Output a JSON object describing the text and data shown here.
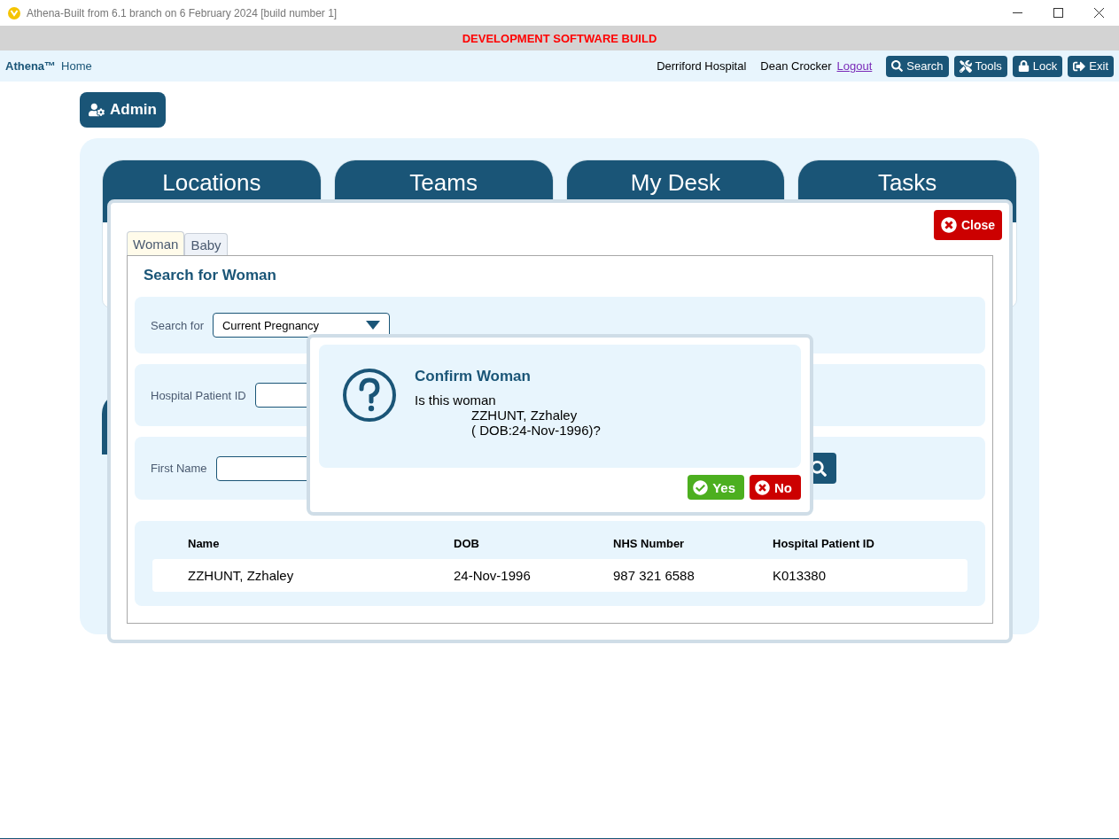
{
  "window": {
    "title": "Athena-Built from 6.1 branch on 6 February 2024 [build number 1]"
  },
  "banner": "DEVELOPMENT SOFTWARE BUILD",
  "nav": {
    "brand": "Athena™",
    "home": "Home",
    "location": "Derriford Hospital",
    "user": "Dean Crocker",
    "logout": "Logout",
    "buttons": [
      {
        "kind": "search",
        "label": "Search"
      },
      {
        "kind": "tools",
        "label": "Tools"
      },
      {
        "kind": "lock",
        "label": "Lock"
      },
      {
        "kind": "exit",
        "label": "Exit"
      }
    ]
  },
  "admin_button": "Admin",
  "tiles": [
    "Locations",
    "Teams",
    "My Desk",
    "Tasks"
  ],
  "search_dialog": {
    "close": "Close",
    "tabs": [
      {
        "label": "Woman",
        "selected": true
      },
      {
        "label": "Baby",
        "selected": false
      }
    ],
    "heading": "Search for Woman",
    "search_for": {
      "label": "Search for",
      "value": "Current Pregnancy"
    },
    "hospital_id": {
      "label": "Hospital Patient ID"
    },
    "first_name": {
      "label": "First Name"
    },
    "results": {
      "columns": [
        "Name",
        "DOB",
        "NHS Number",
        "Hospital Patient ID"
      ],
      "rows": [
        [
          "ZZHUNT, Zzhaley",
          "24-Nov-1996",
          "987 321 6588",
          "K013380"
        ]
      ]
    }
  },
  "confirm": {
    "title": "Confirm Woman",
    "question": "Is this woman",
    "name": "ZZHUNT, Zzhaley",
    "dob": "( DOB:24-Nov-1996)?",
    "buttons": [
      {
        "kind": "yes",
        "label": "Yes"
      },
      {
        "kind": "no",
        "label": "No"
      }
    ]
  }
}
